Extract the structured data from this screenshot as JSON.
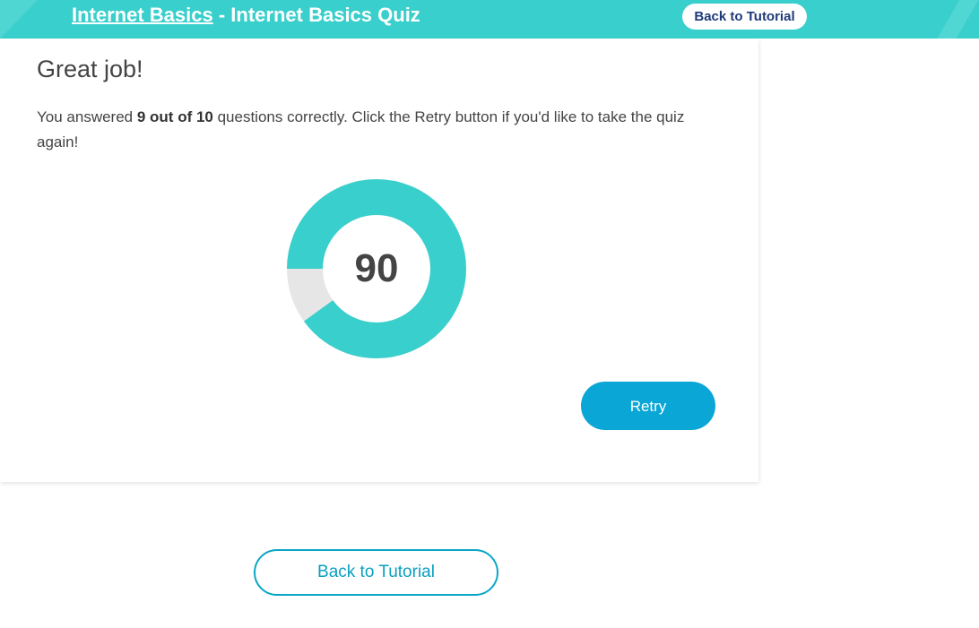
{
  "header": {
    "course_link": "Internet Basics",
    "separator": " - ",
    "quiz_title": "Internet Basics Quiz",
    "back_label": "Back to Tutorial"
  },
  "result": {
    "heading": "Great job!",
    "text_before": "You answered ",
    "score_bold": "9 out of 10",
    "text_after": " questions correctly. Click the Retry button if you'd like to take the quiz again!",
    "score_percent": 90,
    "score_display": "90",
    "retry_label": "Retry"
  },
  "footer": {
    "back_label": "Back to Tutorial"
  },
  "colors": {
    "accent": "#39cfcc",
    "donut_fill": "#39cfcc",
    "donut_empty": "#e6e6e6",
    "button_blue": "#0aa6d6",
    "header_button_text": "#1e3a7a"
  }
}
